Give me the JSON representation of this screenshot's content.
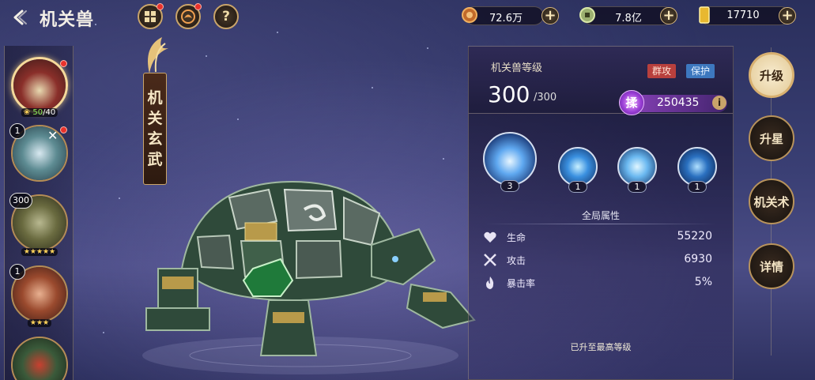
{
  "header": {
    "title": "机关兽",
    "back_icon": "back-arrow-icon",
    "help_label": "?"
  },
  "resources": [
    {
      "name": "gear-token",
      "value": "72.6万",
      "icon": "gear-coin-icon"
    },
    {
      "name": "jade-coin",
      "value": "7.8亿",
      "icon": "jade-coin-icon"
    },
    {
      "name": "gold-ingot",
      "value": "17710",
      "icon": "gold-bar-icon"
    }
  ],
  "beast_list": [
    {
      "level": "",
      "stars": "",
      "fragments_have": "50",
      "fragments_need": "/40",
      "selected": true,
      "color": "#8a2f2a"
    },
    {
      "level": "1",
      "stars": "",
      "fragments_have": "",
      "fragments_need": "",
      "selected": false,
      "color": "#5d8b92"
    },
    {
      "level": "300",
      "stars": "★★★★★",
      "fragments_have": "",
      "fragments_need": "",
      "selected": false,
      "color": "#6a6b40"
    },
    {
      "level": "1",
      "stars": "★★★",
      "fragments_have": "",
      "fragments_need": "",
      "selected": false,
      "color": "#9a4a2e"
    },
    {
      "level": "",
      "stars": "",
      "fragments_have": "",
      "fragments_need": "",
      "selected": false,
      "color": "#3a5a3a"
    }
  ],
  "banner": {
    "chars": [
      "机",
      "关",
      "玄",
      "武"
    ]
  },
  "info": {
    "level_label": "机关兽等级",
    "level_current": "300",
    "level_max": "/300",
    "tag_aoe": "群攻",
    "tag_protect": "保护",
    "power_badge": "揉",
    "power_value": "250435",
    "info_icon": "i",
    "skills": [
      {
        "count": "3",
        "icon": "ice-crystal-icon"
      },
      {
        "count": "1",
        "icon": "water-orb-icon"
      },
      {
        "count": "1",
        "icon": "lotus-ice-icon"
      },
      {
        "count": "1",
        "icon": "water-beast-icon"
      }
    ],
    "section_title": "全局属性",
    "stats": [
      {
        "name": "生命",
        "value": "55220",
        "icon": "heart-icon"
      },
      {
        "name": "攻击",
        "value": "6930",
        "icon": "crossed-swords-icon"
      },
      {
        "name": "暴击率",
        "value": "5%",
        "icon": "flame-icon"
      }
    ],
    "maxed_text": "已升至最高等级"
  },
  "side_menu": [
    {
      "label": "升级",
      "active": true
    },
    {
      "label": "升星",
      "active": false
    },
    {
      "label": "机关术",
      "active": false
    },
    {
      "label": "详情",
      "active": false
    }
  ]
}
